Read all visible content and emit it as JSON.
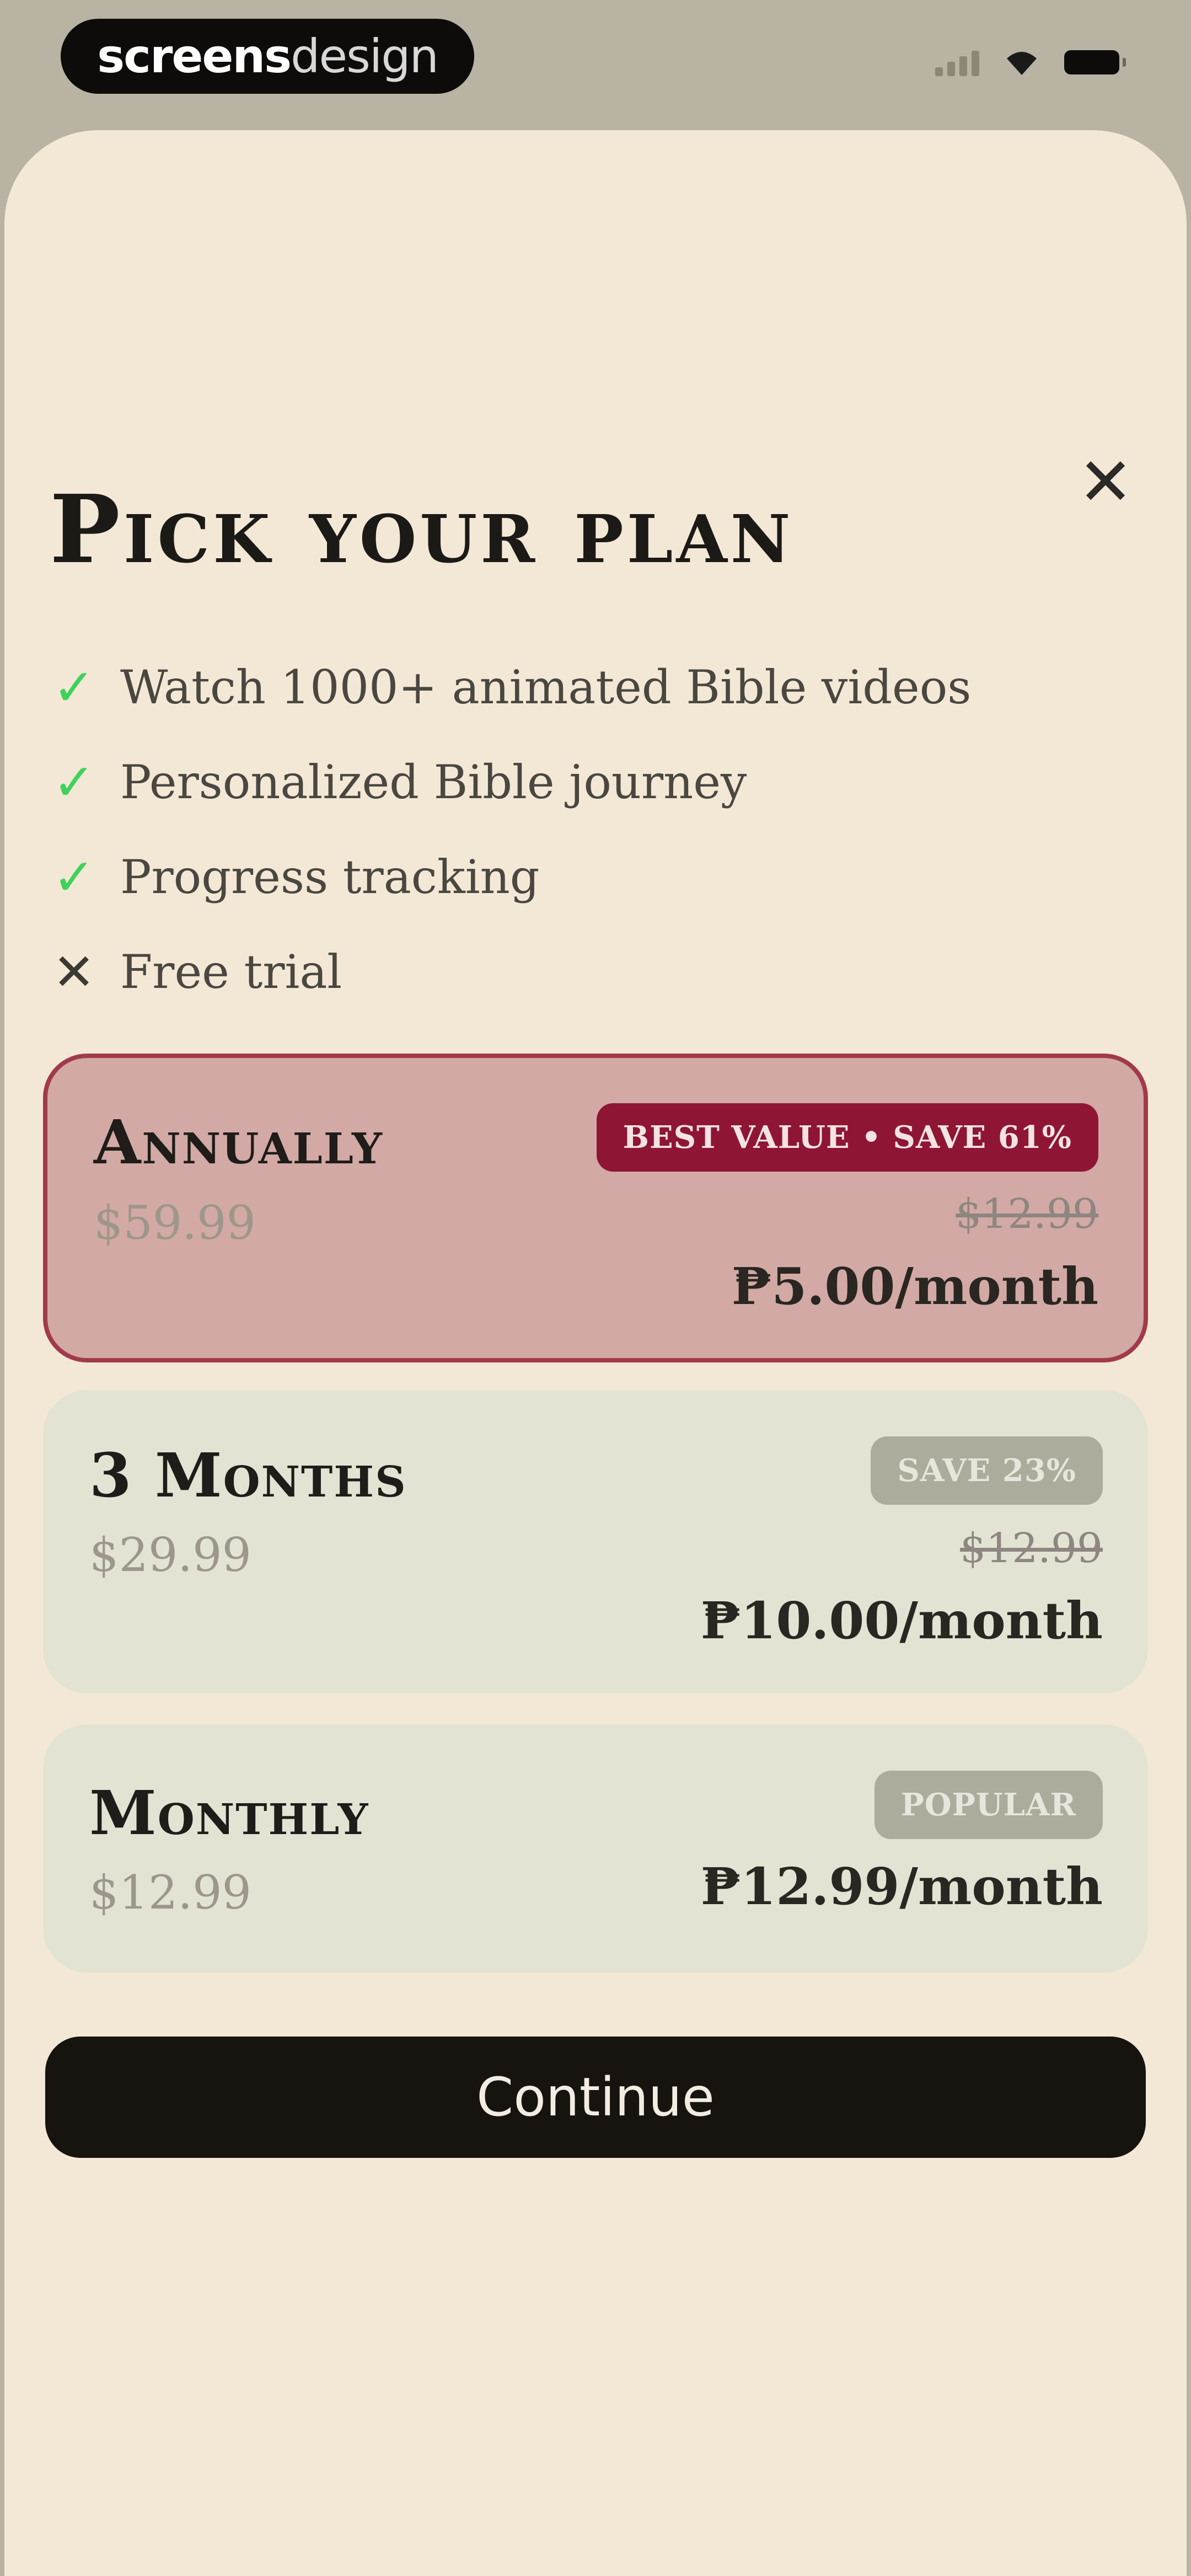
{
  "status_bar": {
    "brand_part1": "screens",
    "brand_part2": "design"
  },
  "paywall": {
    "title": "Pick your plan",
    "close_glyph": "✕",
    "features": [
      {
        "text": "Watch 1000+ animated Bible videos",
        "included": true
      },
      {
        "text": "Personalized Bible journey",
        "included": true
      },
      {
        "text": "Progress tracking",
        "included": true
      },
      {
        "text": "Free trial",
        "included": false
      }
    ],
    "plans": [
      {
        "name": "Annually",
        "total_price": "$59.99",
        "badge": "BEST VALUE • SAVE 61%",
        "original_price": "$12.99",
        "per_month": "₱5.00/month",
        "selected": true
      },
      {
        "name": "3 Months",
        "total_price": "$29.99",
        "badge": "SAVE 23%",
        "original_price": "$12.99",
        "per_month": "₱10.00/month",
        "selected": false
      },
      {
        "name": "Monthly",
        "total_price": "$12.99",
        "badge": "POPULAR",
        "per_month": "₱12.99/month",
        "selected": false
      }
    ],
    "continue_label": "Continue"
  },
  "colors": {
    "check": "#3fd25a",
    "selected_plan_bg": "#d2a9a4",
    "selected_plan_border": "#a13a4c",
    "best_value_badge": "#8f1535",
    "sheet_bg": "#f3e8d6",
    "button_bg": "#17130f"
  },
  "icons": {
    "included": "check-icon",
    "excluded": "cross-icon",
    "close": "close-icon"
  }
}
